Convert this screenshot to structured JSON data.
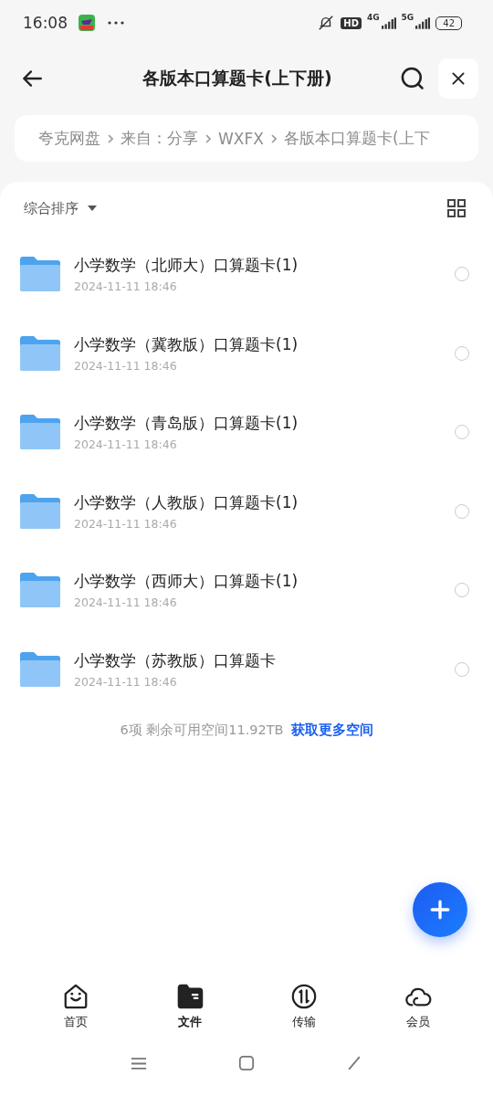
{
  "status_bar": {
    "time": "16:08",
    "hd": "HD",
    "net1": "4G",
    "net2": "5G",
    "battery": "42"
  },
  "header": {
    "title": "各版本口算题卡(上下册)"
  },
  "breadcrumb": [
    "夸克网盘",
    "来自：分享",
    "WXFX",
    "各版本口算题卡(上下"
  ],
  "toolbar": {
    "sort": "综合排序"
  },
  "files": [
    {
      "name": "小学数学（北师大）口算题卡(1)",
      "date": "2024-11-11 18:46",
      "selected": false
    },
    {
      "name": "小学数学（冀教版）口算题卡(1)",
      "date": "2024-11-11 18:46",
      "selected": false
    },
    {
      "name": "小学数学（青岛版）口算题卡(1)",
      "date": "2024-11-11 18:46",
      "selected": false
    },
    {
      "name": "小学数学（人教版）口算题卡(1)",
      "date": "2024-11-11 18:46",
      "selected": false
    },
    {
      "name": "小学数学（西师大）口算题卡(1)",
      "date": "2024-11-11 18:46",
      "selected": false
    },
    {
      "name": "小学数学（苏教版）口算题卡",
      "date": "2024-11-11 18:46",
      "selected": false
    }
  ],
  "footer": {
    "summary": "6项 剩余可用空间11.92TB",
    "link": "获取更多空间"
  },
  "tabs": [
    {
      "kind": "home",
      "label": "首页",
      "selected": false
    },
    {
      "kind": "files",
      "label": "文件",
      "selected": true
    },
    {
      "kind": "transfer",
      "label": "传输",
      "selected": false
    },
    {
      "kind": "member",
      "label": "会员",
      "selected": false
    }
  ]
}
